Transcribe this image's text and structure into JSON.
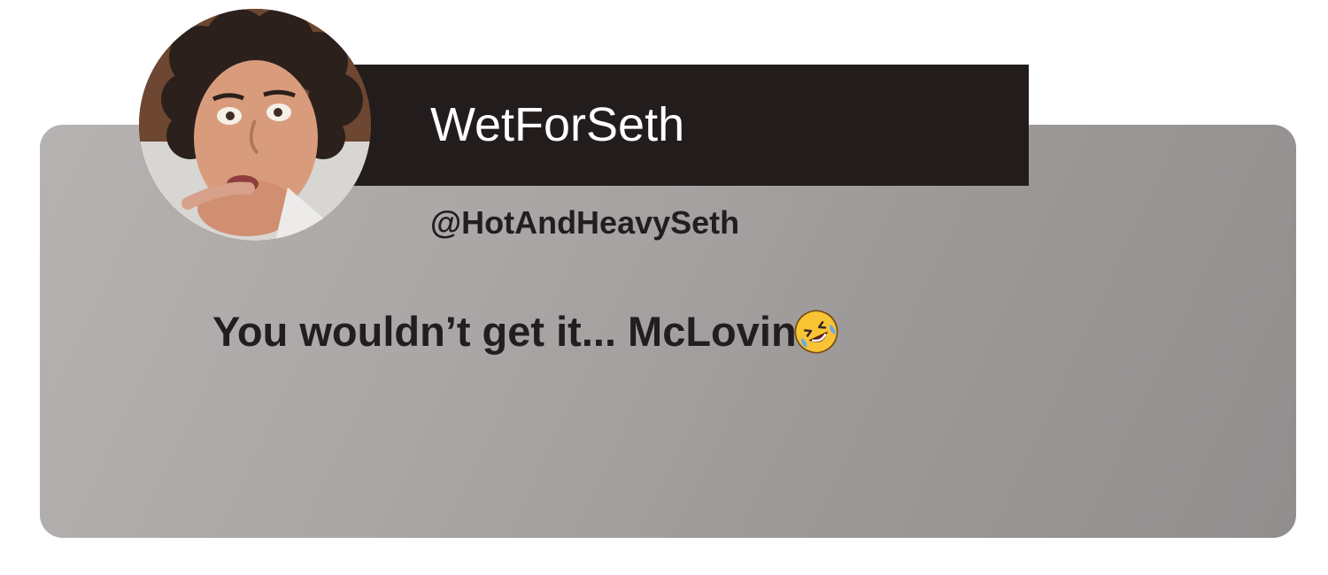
{
  "profile": {
    "display_name": "WetForSeth",
    "handle": "@HotAndHeavySeth",
    "avatar_icon": "curly-haired-man-avatar"
  },
  "post": {
    "text": "You wouldn’t get it... McLovin",
    "emoji_icon": "rolling-on-floor-laughing-emoji"
  },
  "colors": {
    "banner": "#231c1d",
    "card_light": "#b6b2b2",
    "card_dark": "#918e8e",
    "text_dark": "#221d1e",
    "name_text": "#ffffff",
    "emoji_yellow": "#f8c434"
  }
}
